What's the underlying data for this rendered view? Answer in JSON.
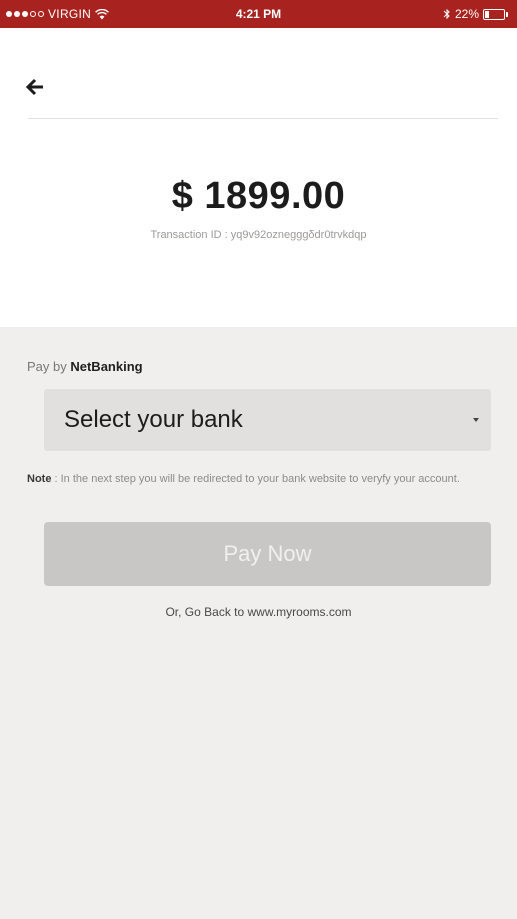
{
  "status_bar": {
    "carrier": "VIRGIN",
    "time": "4:21 PM",
    "battery_text": "22%",
    "battery_level": 0.22,
    "signal_filled": 3,
    "signal_total": 5,
    "icons": [
      "wifi-icon",
      "bluetooth-icon",
      "battery-icon"
    ],
    "background_color": "#a8231f"
  },
  "header": {
    "back_icon": "back-arrow-icon"
  },
  "transaction": {
    "amount": "$ 1899.00",
    "id_text": "Transaction ID : yq9v92oznegggδdr0trvkdqp"
  },
  "payment": {
    "pay_by_prefix": "Pay by ",
    "pay_by_method": "NetBanking",
    "bank_select_label": "Select your bank",
    "note_label": "Note",
    "note_text": " : In the next step you will be redirected to your bank website to veryfy your account.",
    "pay_button_label": "Pay Now",
    "go_back_prefix": "Or, Go Back to ",
    "go_back_link": "www.myrooms.com"
  }
}
